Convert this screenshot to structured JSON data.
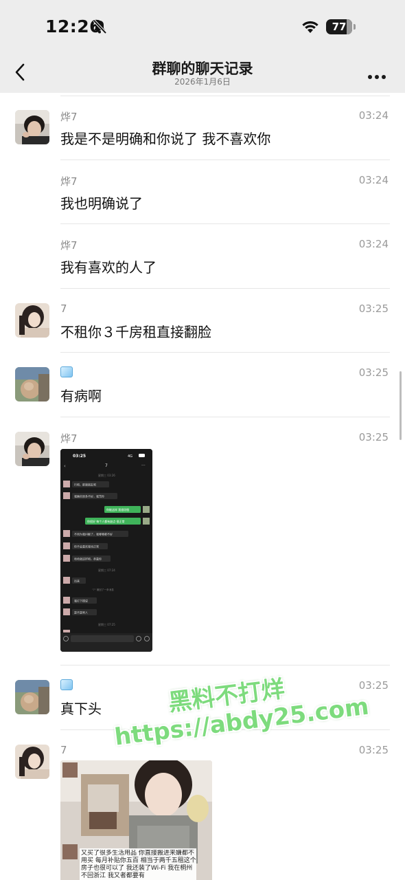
{
  "status_bar": {
    "time": "12:26",
    "battery": "77"
  },
  "nav": {
    "title": "群聊的聊天记录",
    "subtitle": "2026年1月6日"
  },
  "messages": [
    {
      "sender": "烨7",
      "time": "03:24",
      "text": "我是不是明确和你说了 我不喜欢你",
      "avatar": "avatar-boy"
    },
    {
      "sender": "烨7",
      "time": "03:24",
      "text": "我也明确说了"
    },
    {
      "sender": "烨7",
      "time": "03:24",
      "text": "我有喜欢的人了"
    },
    {
      "sender": "7",
      "time": "03:25",
      "text": "不租你３千房租直接翻脸",
      "avatar": "avatar-girl"
    },
    {
      "sender": "",
      "time": "03:25",
      "text": "有病啊",
      "avatar": "avatar-cat",
      "sender_icon": "ice-cube-icon"
    },
    {
      "sender": "烨7",
      "time": "03:25",
      "text": "",
      "avatar": "avatar-boy",
      "attachment": "screenshot"
    },
    {
      "sender": "",
      "time": "03:25",
      "text": "真下头",
      "avatar": "avatar-cat",
      "sender_icon": "ice-cube-icon"
    },
    {
      "sender": "7",
      "time": "03:25",
      "text": "",
      "avatar": "avatar-girl",
      "attachment": "photo"
    }
  ],
  "embedded_screenshot": {
    "status_time": "03:25",
    "status_right": "4G",
    "header": "7",
    "date_label_1": "星期三 03:26",
    "lines_left": [
      "行吧，那就朋友吧",
      "我确实很多不好，我骂你",
      "不用为我抖解了，我哪哪都不好",
      "你不会喜欢我也正常",
      "哈哈就这样吧，恭喜你"
    ],
    "lines_right": [
      "你能这样 我很欣慰",
      "你很好 每个人都有缺点 很正常"
    ],
    "date_label_2": "星期三 07:24",
    "line_out": "出来",
    "recall": "\"7\" 撤回了一条消息",
    "lines_left_2": [
      "我打下楼说",
      "是不是男人"
    ],
    "date_label_3": "星期三 07:25"
  },
  "embedded_photo": {
    "caption": "又买了很多生活用品 你直接搬进来嫌都不用买 每月补贴你五百 相当于两千五租这个房子也很可以了 我还装了Wi-Fi 我在桐州 不回浙江 我又者都要有"
  },
  "watermark": {
    "line1": "黑料不打烊",
    "line2": "https://abdy25.com"
  },
  "colors": {
    "green_bubble": "#95ec69",
    "watermark": "#7ddb7d",
    "background": "#ffffff",
    "bar": "#ededed"
  }
}
